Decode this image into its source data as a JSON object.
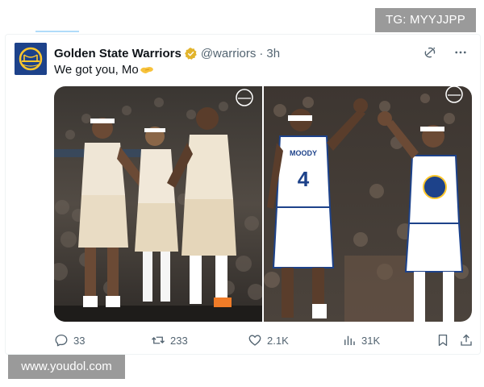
{
  "watermarks": {
    "top_right": "TG: MYYJJPP",
    "bottom_left": "www.youdol.com"
  },
  "tweet": {
    "author": {
      "display_name": "Golden State Warriors",
      "handle": "@warriors",
      "time_ago": "3h",
      "verified": true,
      "verified_color": "#e2b42c",
      "avatar_bg": "#1d428a",
      "avatar_icon": "warriors-bridge-logo"
    },
    "text": "We got you, Mo",
    "text_emoji": "handshake-emoji",
    "media": [
      {
        "description_icon": "photo-three-players-in-white-jerseys",
        "alt": "photo 1"
      },
      {
        "description_icon": "photo-high-five-moody-number-4",
        "alt": "photo 2",
        "jersey_name": "MOODY",
        "jersey_number": "4"
      }
    ],
    "actions": {
      "replies": "33",
      "reposts": "233",
      "likes": "2.1K",
      "views": "31K"
    },
    "header_icons": [
      "grok-icon",
      "more-options-icon"
    ],
    "footer_icons": [
      "bookmark-icon",
      "share-icon"
    ]
  },
  "colors": {
    "text_primary": "#0f1419",
    "text_secondary": "#536471",
    "warriors_blue": "#1d428a",
    "warriors_gold": "#ffc72c"
  }
}
